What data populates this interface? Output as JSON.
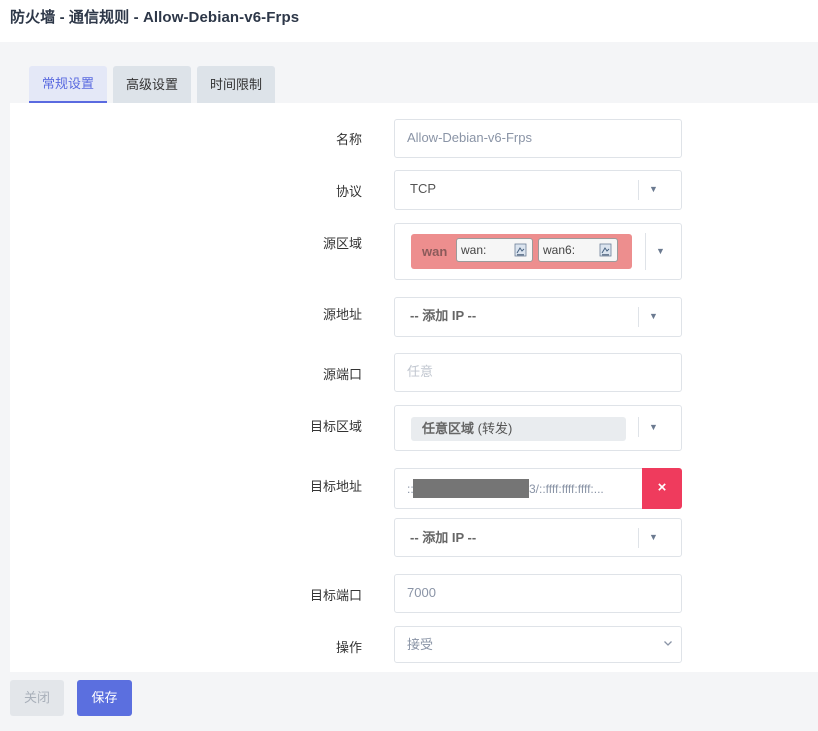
{
  "header": {
    "title": "防火墙 - 通信规则 - Allow-Debian-v6-Frps"
  },
  "tabs": [
    {
      "label": "常规设置",
      "active": true
    },
    {
      "label": "高级设置",
      "active": false
    },
    {
      "label": "时间限制",
      "active": false
    }
  ],
  "form": {
    "name": {
      "label": "名称",
      "value": "Allow-Debian-v6-Frps"
    },
    "protocol": {
      "label": "协议",
      "value": "TCP"
    },
    "src_zone": {
      "label": "源区域",
      "zone": "wan",
      "devices": [
        "wan:",
        "wan6:"
      ],
      "zone_color": "#ed8e8e"
    },
    "src_addr": {
      "label": "源地址",
      "value": "-- 添加 IP --"
    },
    "src_port": {
      "label": "源端口",
      "placeholder": "任意"
    },
    "dest_zone": {
      "label": "目标区域",
      "value_bold": "任意区域",
      "value_suffix": "(转发)"
    },
    "dest_addr": {
      "label": "目标地址",
      "entry_prefix": "::",
      "entry_suffix": "3/::ffff:ffff:ffff:...",
      "delete_symbol": "×",
      "add_value": "-- 添加 IP --"
    },
    "dest_port": {
      "label": "目标端口",
      "value": "7000"
    },
    "action": {
      "label": "操作",
      "value": "接受"
    }
  },
  "footer": {
    "close_label": "关闭",
    "save_label": "保存"
  },
  "colors": {
    "accent": "#5b6fdf",
    "danger": "#ef3b5d"
  }
}
